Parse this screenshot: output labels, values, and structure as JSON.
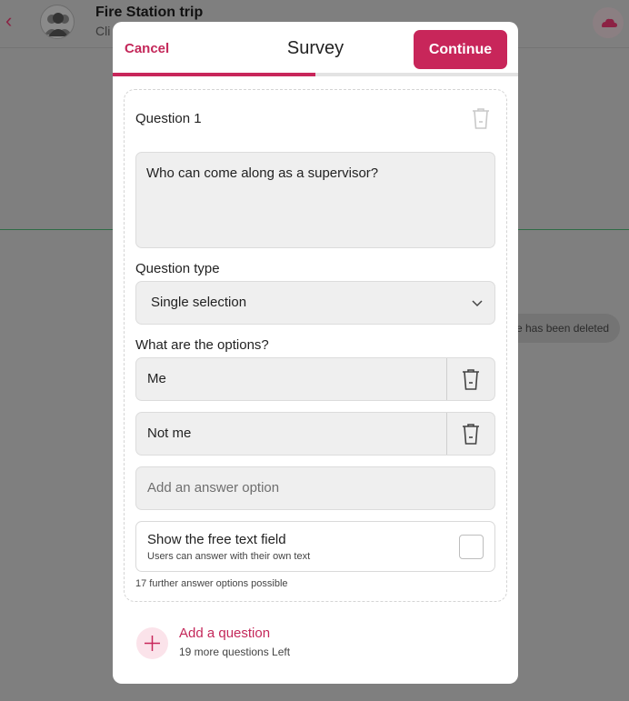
{
  "background": {
    "chat_title": "Fire Station trip",
    "chat_subtitle": "Cli",
    "deleted_notice": "e has been deleted"
  },
  "modal": {
    "cancel_label": "Cancel",
    "title": "Survey",
    "continue_label": "Continue",
    "progress_fraction": 0.5
  },
  "question": {
    "label": "Question 1",
    "text": "Who can come along as a supervisor?",
    "type_label": "Question type",
    "type_value": "Single selection",
    "options_label": "What are the options?",
    "options": [
      "Me",
      "Not me"
    ],
    "add_option_placeholder": "Add an answer option",
    "free_text_title": "Show the free text field",
    "free_text_subtitle": "Users can answer with their own text",
    "free_text_checked": false,
    "further_options_note": "17 further answer options possible"
  },
  "add_question": {
    "label": "Add a question",
    "remaining": "19 more questions Left"
  },
  "colors": {
    "accent": "#c8265a",
    "field_bg": "#efefef",
    "backdrop": "#7f7f7f"
  },
  "icons": [
    "chevron-left-icon",
    "group-avatar-icon",
    "trash-icon",
    "chevron-down-icon",
    "plus-icon"
  ]
}
